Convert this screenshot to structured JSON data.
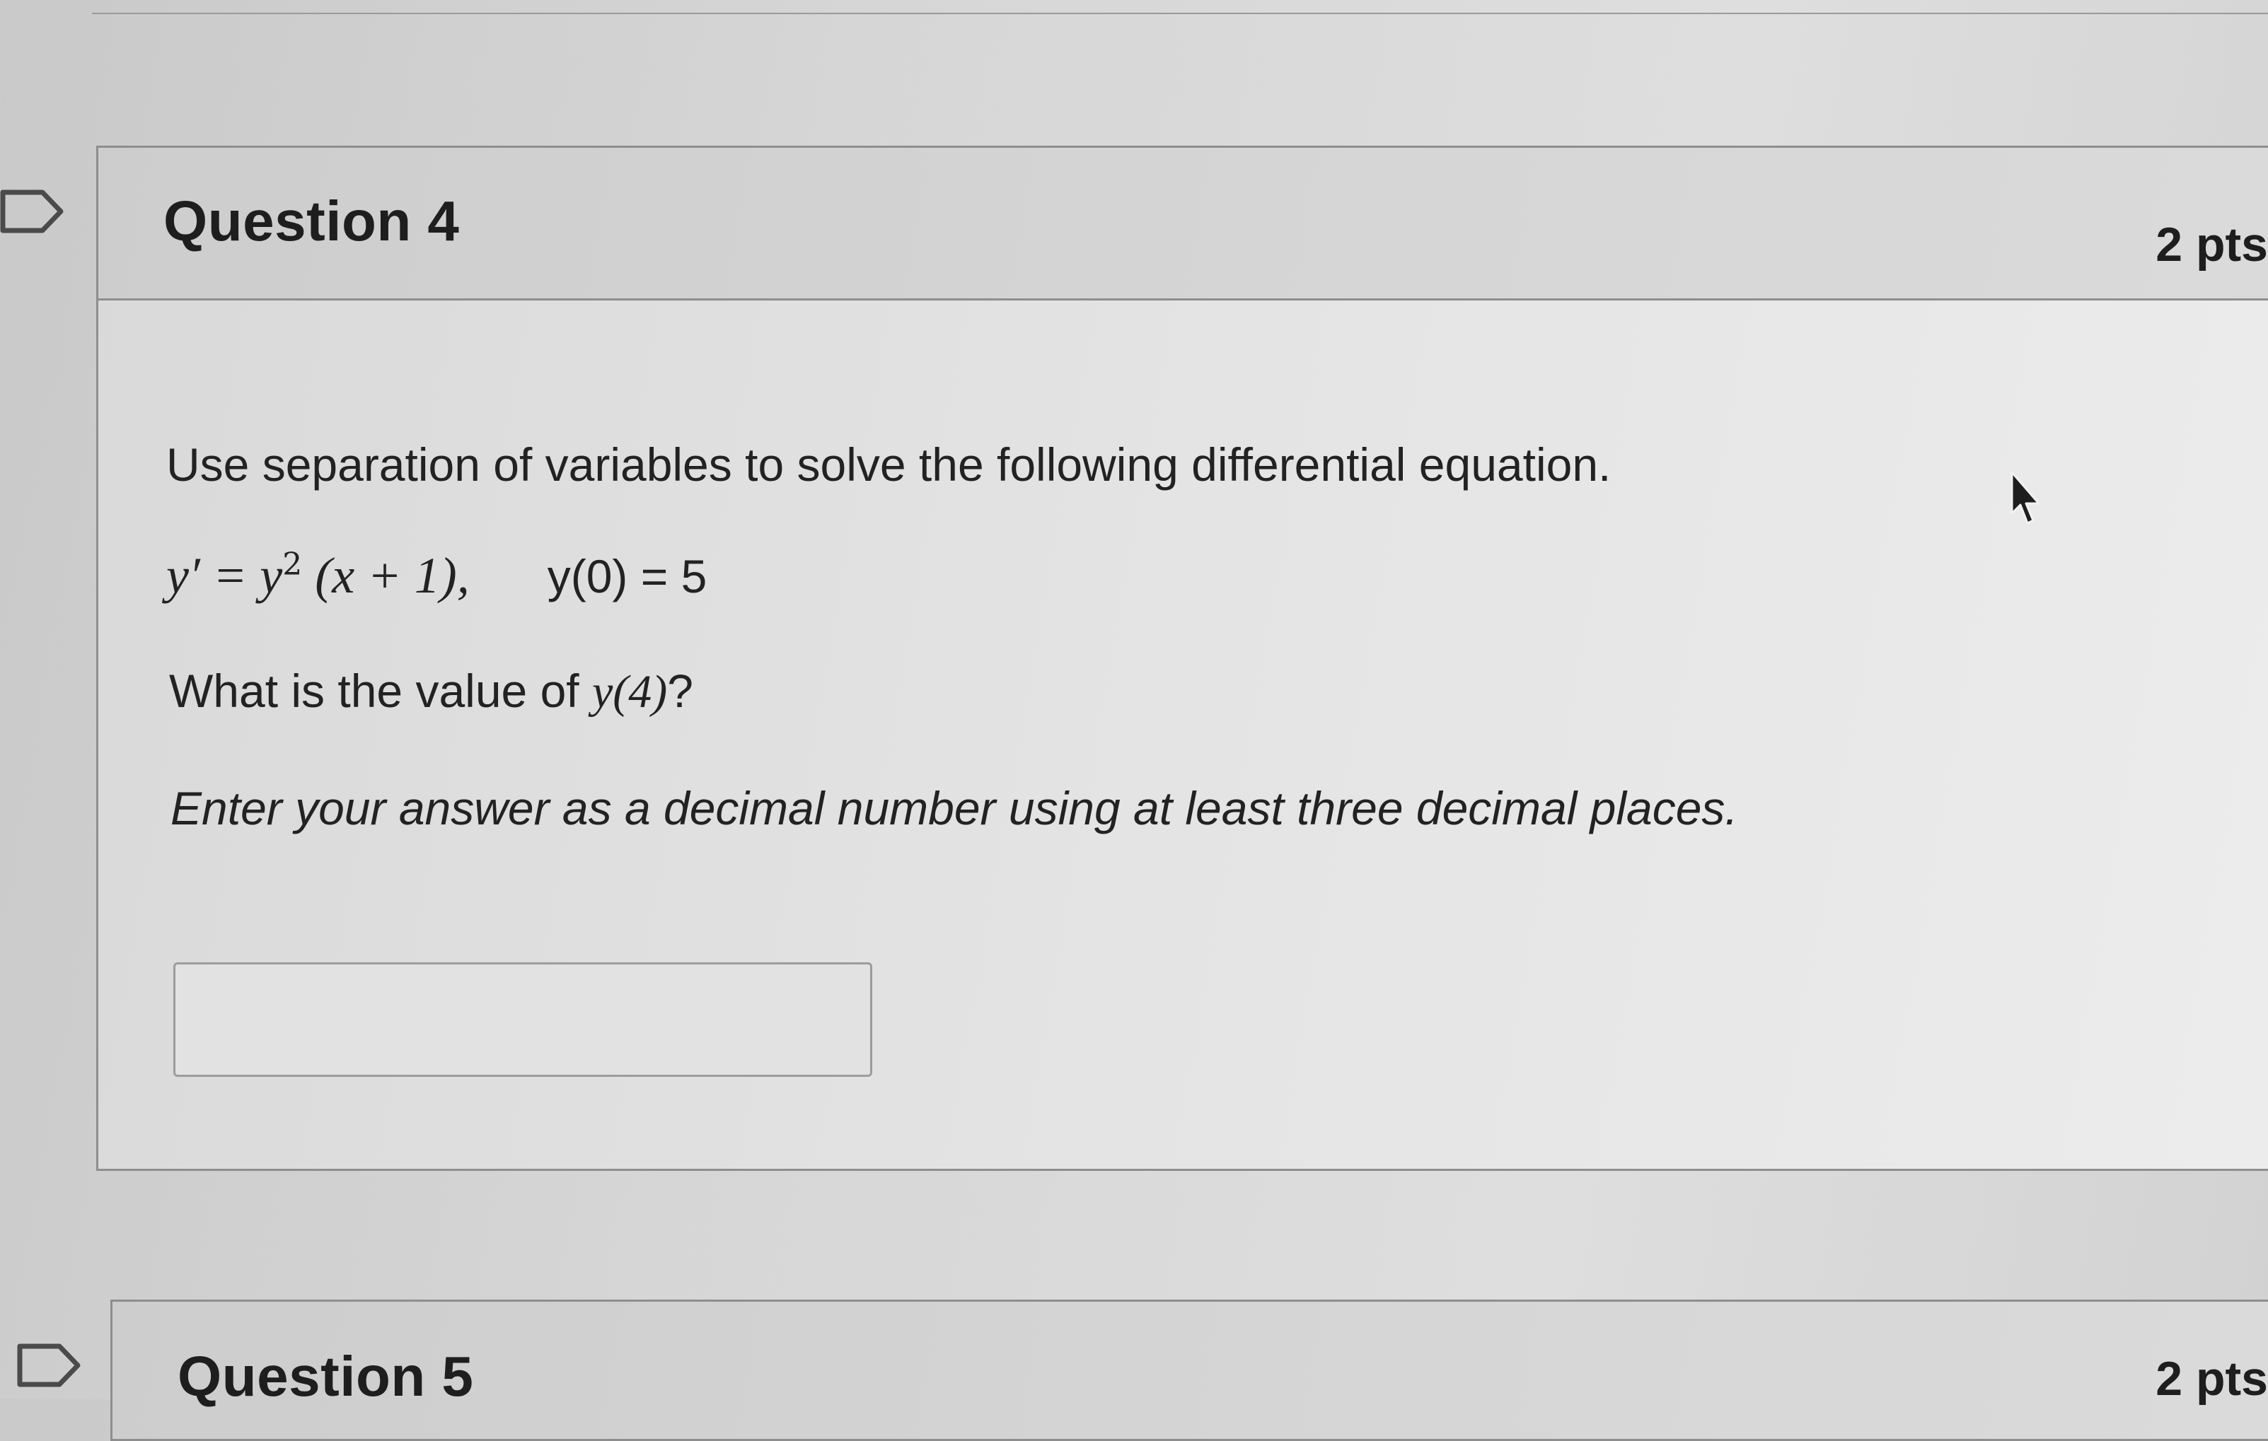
{
  "questions": [
    {
      "title": "Question 4",
      "points": "2 pts",
      "prompt": "Use separation of variables to solve the following differential equation.",
      "equation": {
        "lhs": "y′ = y",
        "exponent": "2",
        "rhs": " (x + 1),",
        "initial_condition": "y(0) = 5"
      },
      "question_prefix": "What is the value of ",
      "question_var": "y(4)",
      "question_suffix": "?",
      "instruction": "Enter your answer as a decimal number using at least three decimal places.",
      "answer_value": ""
    },
    {
      "title": "Question 5",
      "points": "2 pts"
    }
  ],
  "icons": {
    "flag": "bookmark-flag-icon",
    "cursor": "mouse-pointer-icon"
  },
  "colors": {
    "border": "#8e8e8e",
    "text": "#1f1f1f"
  }
}
